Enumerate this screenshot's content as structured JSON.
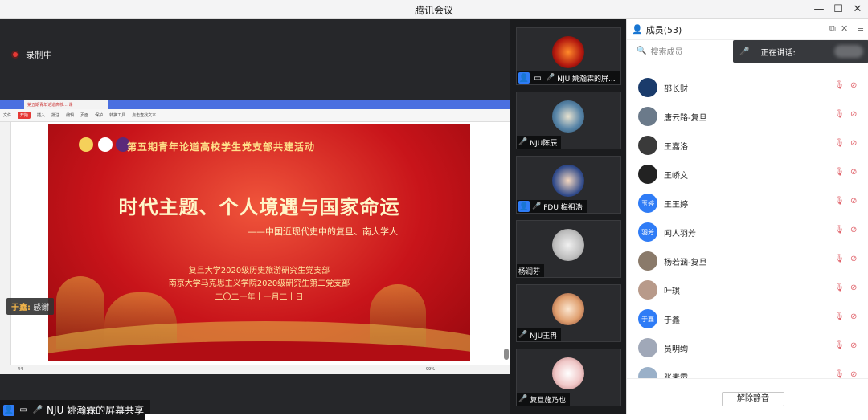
{
  "window": {
    "title": "腾讯会议"
  },
  "recording": {
    "label": "录制中"
  },
  "share": {
    "browser_tab": "第五期青年论道高校... 课",
    "toolbar_items": [
      "文件",
      "开始",
      "插入",
      "批注",
      "编辑",
      "页面",
      "保护",
      "转换工具",
      "点击查找文本"
    ],
    "status_page": "44",
    "zoom": "99%",
    "slide": {
      "header": "第五期青年论道高校学生党支部共建活动",
      "title": "时代主题、个人境遇与国家命运",
      "subtitle": "——中国近现代史中的复旦、南大学人",
      "org1": "复旦大学2020级历史旅游研究生党支部",
      "org2": "南京大学马克思主义学院2020级研究生第二党支部",
      "date": "二〇二一年十一月二十日"
    }
  },
  "chat_caption": {
    "name": "于鑫:",
    "text": "感谢"
  },
  "sharer": {
    "label": "NJU 姚瀚霖的屏幕共享"
  },
  "gallery": [
    {
      "name": "NJU 姚瀚霖的屏...",
      "avatar_color": "#d9321c"
    },
    {
      "name": "NJU陈辰",
      "avatar_color": "#3e6b8e"
    },
    {
      "name": "FDU 梅祖浩",
      "avatar_color": "#2f4f8c"
    },
    {
      "name": "杨润芬",
      "avatar_color": "#c9c9c9"
    },
    {
      "name": "NJU王冉",
      "avatar_color": "#f2c9a0"
    },
    {
      "name": "复旦施乃也",
      "avatar_color": "#e8b8b8"
    }
  ],
  "members_panel": {
    "title": "成员(53)",
    "search_placeholder": "搜索成员",
    "speaking_label": "正在讲话:",
    "members": [
      {
        "name": "邵长财",
        "avatar_text": "",
        "avatar_color": "#1a3b6b"
      },
      {
        "name": "唐云路-复旦",
        "avatar_text": "",
        "avatar_color": "#6b7a8a"
      },
      {
        "name": "王嘉洛",
        "avatar_text": "",
        "avatar_color": "#3a3a3a"
      },
      {
        "name": "王峤文",
        "avatar_text": "",
        "avatar_color": "#222222"
      },
      {
        "name": "王王婷",
        "avatar_text": "玉婷",
        "avatar_color": "#2f7cf6"
      },
      {
        "name": "闻人羽芳",
        "avatar_text": "羽芳",
        "avatar_color": "#2f7cf6"
      },
      {
        "name": "杨若涵-复旦",
        "avatar_text": "",
        "avatar_color": "#8a7a6a"
      },
      {
        "name": "叶琪",
        "avatar_text": "",
        "avatar_color": "#b89a8a"
      },
      {
        "name": "于鑫",
        "avatar_text": "于鑫",
        "avatar_color": "#2f7cf6"
      },
      {
        "name": "员明绚",
        "avatar_text": "",
        "avatar_color": "#a0a8b8"
      },
      {
        "name": "张素霞",
        "avatar_text": "",
        "avatar_color": "#9ab0c8"
      }
    ],
    "unmute_button": "解除静音"
  }
}
